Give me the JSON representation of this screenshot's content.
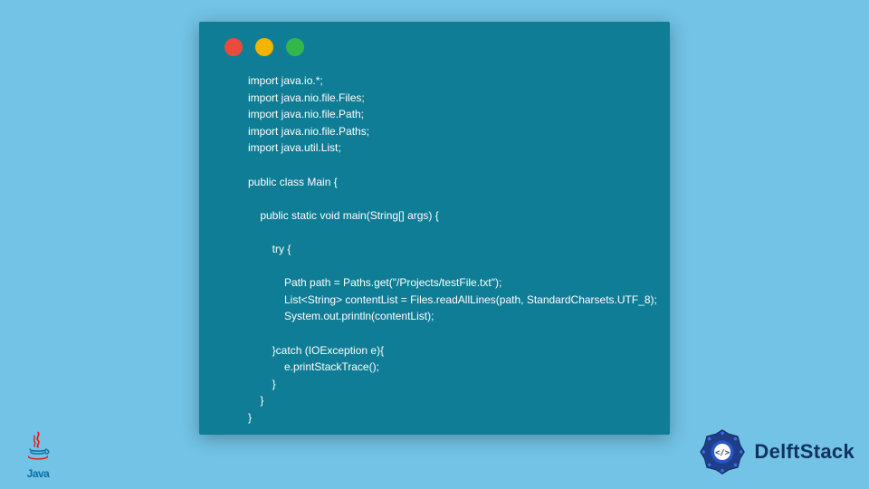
{
  "code_window": {
    "traffic": {
      "red": "#e94b3c",
      "yellow": "#f4b400",
      "green": "#33b74b"
    },
    "code": "import java.io.*;\nimport java.nio.file.Files;\nimport java.nio.file.Path;\nimport java.nio.file.Paths;\nimport java.util.List;\n\npublic class Main {\n\n    public static void main(String[] args) {\n\n        try {\n\n            Path path = Paths.get(\"/Projects/testFile.txt\");\n            List<String> contentList = Files.readAllLines(path, StandardCharsets.UTF_8);\n            System.out.println(contentList);\n\n        }catch (IOException e){\n            e.printStackTrace();\n        }\n    }\n}"
  },
  "java_logo": {
    "label": "Java"
  },
  "delftstack": {
    "label": "DelftStack"
  }
}
